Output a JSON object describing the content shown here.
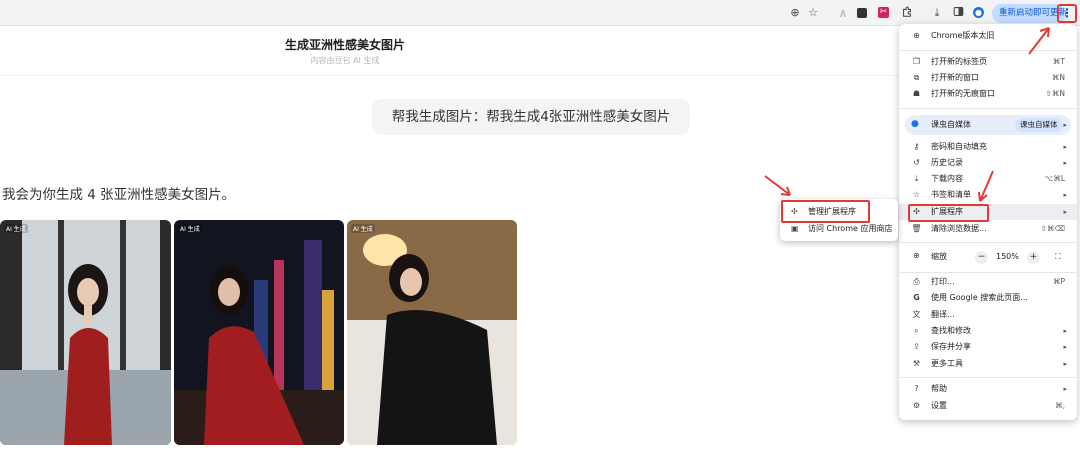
{
  "toolbar": {
    "icons": [
      "zoom-icon",
      "bookmark-star-icon",
      "extension-a-icon",
      "extension-b-icon",
      "extension-c-icon",
      "extensions-puzzle-icon",
      "download-icon",
      "side-panel-icon",
      "profile-icon"
    ],
    "update_label": "重新启动即可更新",
    "menu_glyph": "⋮"
  },
  "chat": {
    "title": "生成亚洲性感美女图片",
    "subtitle": "内容由豆包 AI 生成",
    "user_message": "帮我生成图片：帮我生成4张亚洲性感美女图片",
    "reply": "我会为你生成 4 张亚洲性感美女图片。",
    "image_tag": "AI 生成",
    "images": [
      "ai-image-1",
      "ai-image-2",
      "ai-image-3"
    ]
  },
  "menu": {
    "version_notice": "Chrome版本太旧",
    "new_tab": {
      "label": "打开新的标签页",
      "shortcut": "⌘T"
    },
    "new_window": {
      "label": "打开新的窗口",
      "shortcut": "⌘N"
    },
    "incognito": {
      "label": "打开新的无痕窗口",
      "shortcut": "⇧⌘N"
    },
    "profile": {
      "label": "课虫自媒体",
      "chip": "课虫自媒体"
    },
    "passwords": {
      "label": "密码和自动填充"
    },
    "history": {
      "label": "历史记录"
    },
    "downloads": {
      "label": "下载内容",
      "shortcut": "⌥⌘L"
    },
    "bookmarks": {
      "label": "书签和清单"
    },
    "extensions": {
      "label": "扩展程序"
    },
    "clear_data": {
      "label": "清除浏览数据...",
      "shortcut": "⇧⌘⌫"
    },
    "zoom": {
      "label": "缩放",
      "minus": "−",
      "value": "150%",
      "plus": "+",
      "fullscreen": "⛶"
    },
    "print": {
      "label": "打印...",
      "shortcut": "⌘P"
    },
    "google_search": {
      "label": "使用 Google 搜索此页面..."
    },
    "translate": {
      "label": "翻译..."
    },
    "find_edit": {
      "label": "查找和修改"
    },
    "save_share": {
      "label": "保存并分享"
    },
    "more_tools": {
      "label": "更多工具"
    },
    "help": {
      "label": "帮助"
    },
    "settings": {
      "label": "设置",
      "shortcut": "⌘,"
    }
  },
  "submenu": {
    "manage": "管理扩展程序",
    "store": "访问 Chrome 应用商店"
  },
  "colors": {
    "highlight_border": "#e53935",
    "accent": "#1a73e8",
    "update_chip_bg": "#c2dbff"
  }
}
